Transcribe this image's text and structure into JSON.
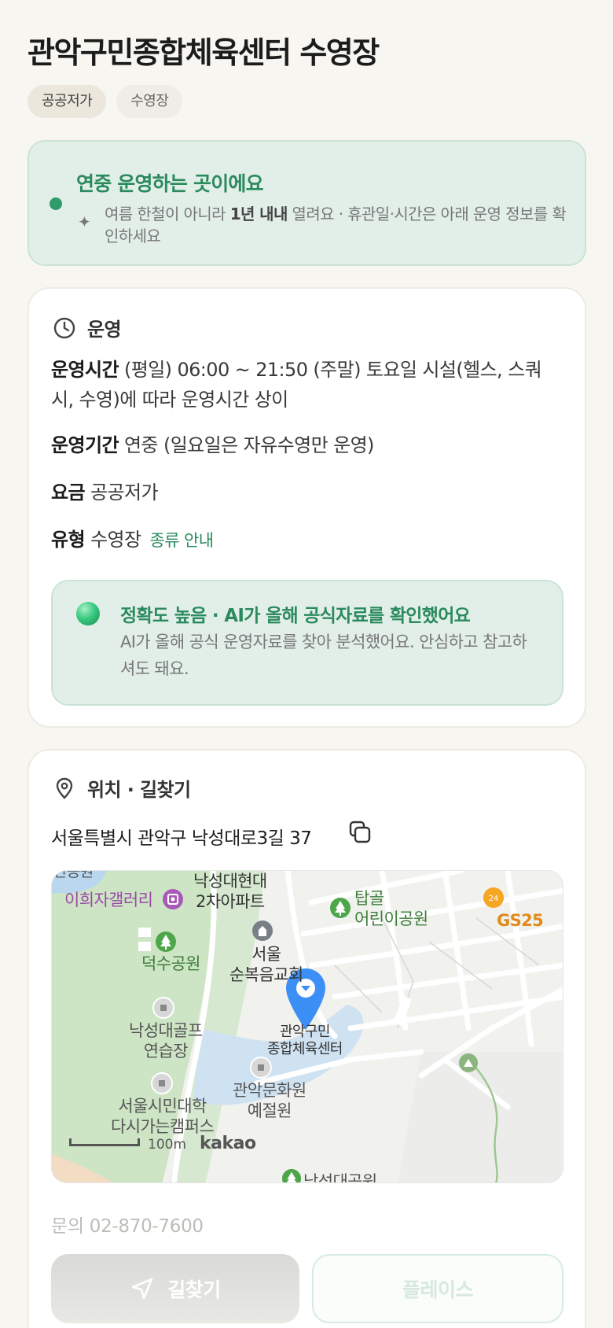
{
  "facility": {
    "title": "관악구민종합체육센터 수영장",
    "chips": [
      "공공저가",
      "수영장"
    ]
  },
  "banner": {
    "title": "연중 운영하는 곳이에요",
    "desc_pre": "여름 한철이 아니라 ",
    "desc_bold": "1년 내내",
    "desc_post": " 열려요 · 휴관일·시간은 아래 운영 정보를 확인하세요"
  },
  "operation": {
    "section_label": "운영",
    "hours_label": "운영시간",
    "hours_value": "(평일) 06:00 ~ 21:50 (주말) 토요일 시설(헬스, 스쿼시, 수영)에 따라 운영시간 상이",
    "period_label": "운영기간",
    "period_value": "연중 (일요일은 자유수영만 운영)",
    "fee_label": "요금",
    "fee_value": "공공저가",
    "type_label": "유형",
    "type_value": "수영장",
    "type_link": "종류 안내"
  },
  "ai_notice": {
    "title": "정확도 높음 · AI가 올해 공식자료를 확인했어요",
    "desc": "AI가 올해 공식 운영자료를 찾아 분석했어요. 안심하고 참고하셔도 돼요."
  },
  "location": {
    "section_label": "위치 · 길찾기",
    "address": "서울특별시 관악구 낙성대로3길 37",
    "map_labels": {
      "top_cut": "관공원",
      "gallery": "이희자갤러리",
      "apt": "낙성대현대\n2차아파트",
      "tapgol": "탑골\n어린이공원",
      "gs25": "GS25",
      "deoksu": "덕수공원",
      "church": "서울\n순복음교회",
      "target": "관악구민\n종합체육센터",
      "golf": "낙성대골프\n연습장",
      "culture": "관악문화원\n예절원",
      "univ": "서울시민대학\n다시가는캠퍼스",
      "park_bottom": "낙성대공원",
      "scale": "100m",
      "brand": "kakao"
    },
    "phone": "문의 02-870-7600",
    "directions_button": "길찾기",
    "place_button": "플레이스"
  },
  "colors": {
    "accent_green": "#2a8a5d",
    "banner_bg": "#e2efe8",
    "pin_blue": "#3b8ff5"
  }
}
